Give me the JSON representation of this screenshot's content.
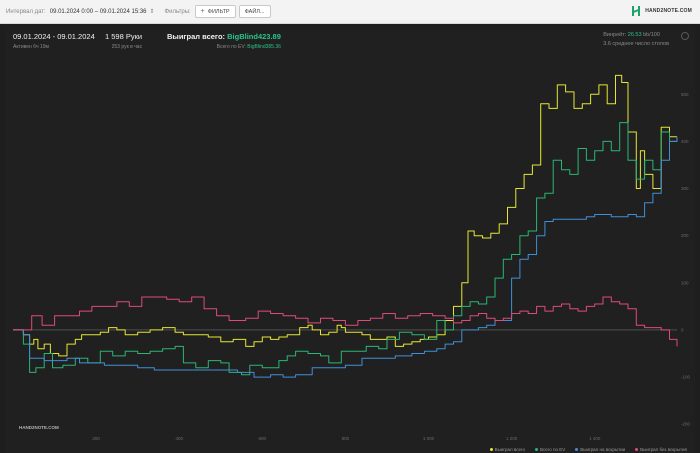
{
  "topbar": {
    "date_label": "Интервал дат:",
    "date_range": "09.01.2024 0:00 – 09.01.2024 15:36",
    "filters_label": "Фильтры:",
    "filter_button": "ФИЛЬТР",
    "file_button": "ФАЙЛ...",
    "logo_text": "HAND2NOTE.COM"
  },
  "stats": {
    "date_range": "09.01.2024 - 09.01.2024",
    "active": "Активен 6ч 19м",
    "hands": "1 598 Руки",
    "hands_per_hour": "253 рук в час",
    "won_label": "Выиграл всего:",
    "won_value": "BigBlind423.89",
    "ev_label": "Всего по EV:",
    "ev_value": "BigBlind385.36",
    "winrate_label": "Винрейт:",
    "winrate_value": "26.53",
    "winrate_unit": "bb/100",
    "tables": "3.6 среднее число столов"
  },
  "colors": {
    "total": "#e6e632",
    "ev": "#2bb673",
    "showdown": "#3f8fd8",
    "nonshowdown": "#e04a7a",
    "accent": "#29c38a"
  },
  "watermark": "HAND2NOTE.COM",
  "chart_data": {
    "type": "line",
    "xlabel": "",
    "ylabel": "",
    "x_ticks": [
      "200",
      "400",
      "600",
      "800",
      "1 000",
      "1 200",
      "1 400"
    ],
    "y_ticks": [
      "500",
      "400",
      "300",
      "200",
      "100",
      "0",
      "-100",
      "-200"
    ],
    "ylim": [
      -225,
      560
    ],
    "xlim": [
      0,
      1598
    ],
    "grid": false,
    "legend_position": "bottom-right",
    "series": [
      {
        "name": "Выиграл всего",
        "color": "#e6e632",
        "points": [
          [
            0,
            0
          ],
          [
            25,
            -10
          ],
          [
            40,
            -30
          ],
          [
            50,
            -20
          ],
          [
            60,
            -40
          ],
          [
            75,
            -30
          ],
          [
            90,
            -50
          ],
          [
            110,
            -55
          ],
          [
            130,
            -30
          ],
          [
            150,
            -20
          ],
          [
            165,
            -10
          ],
          [
            190,
            -10
          ],
          [
            210,
            -5
          ],
          [
            230,
            5
          ],
          [
            250,
            0
          ],
          [
            270,
            -10
          ],
          [
            300,
            -5
          ],
          [
            330,
            0
          ],
          [
            360,
            5
          ],
          [
            390,
            -5
          ],
          [
            410,
            -10
          ],
          [
            440,
            -10
          ],
          [
            470,
            -15
          ],
          [
            500,
            -25
          ],
          [
            530,
            -20
          ],
          [
            560,
            -35
          ],
          [
            580,
            -25
          ],
          [
            600,
            -15
          ],
          [
            620,
            -20
          ],
          [
            640,
            -15
          ],
          [
            660,
            -10
          ],
          [
            690,
            5
          ],
          [
            710,
            10
          ],
          [
            720,
            0
          ],
          [
            740,
            -10
          ],
          [
            760,
            -5
          ],
          [
            780,
            10
          ],
          [
            790,
            5
          ],
          [
            800,
            -5
          ],
          [
            820,
            -5
          ],
          [
            840,
            -10
          ],
          [
            860,
            -20
          ],
          [
            880,
            -20
          ],
          [
            900,
            -15
          ],
          [
            920,
            -35
          ],
          [
            940,
            -30
          ],
          [
            960,
            -25
          ],
          [
            980,
            -20
          ],
          [
            1000,
            -15
          ],
          [
            1020,
            -10
          ],
          [
            1040,
            20
          ],
          [
            1060,
            50
          ],
          [
            1080,
            100
          ],
          [
            1095,
            210
          ],
          [
            1110,
            200
          ],
          [
            1130,
            195
          ],
          [
            1150,
            205
          ],
          [
            1170,
            225
          ],
          [
            1190,
            260
          ],
          [
            1210,
            300
          ],
          [
            1230,
            330
          ],
          [
            1250,
            350
          ],
          [
            1270,
            480
          ],
          [
            1290,
            470
          ],
          [
            1310,
            520
          ],
          [
            1330,
            505
          ],
          [
            1350,
            470
          ],
          [
            1370,
            480
          ],
          [
            1390,
            500
          ],
          [
            1410,
            520
          ],
          [
            1430,
            480
          ],
          [
            1450,
            540
          ],
          [
            1465,
            525
          ],
          [
            1480,
            420
          ],
          [
            1500,
            300
          ],
          [
            1510,
            380
          ],
          [
            1520,
            330
          ],
          [
            1540,
            300
          ],
          [
            1560,
            430
          ],
          [
            1580,
            410
          ],
          [
            1598,
            410
          ]
        ]
      },
      {
        "name": "Всего по EV",
        "color": "#2bb673",
        "points": [
          [
            0,
            0
          ],
          [
            25,
            -30
          ],
          [
            40,
            -90
          ],
          [
            55,
            -80
          ],
          [
            75,
            -50
          ],
          [
            95,
            -80
          ],
          [
            120,
            -75
          ],
          [
            150,
            -60
          ],
          [
            180,
            -70
          ],
          [
            210,
            -45
          ],
          [
            240,
            -55
          ],
          [
            270,
            -45
          ],
          [
            300,
            -50
          ],
          [
            330,
            -45
          ],
          [
            360,
            -40
          ],
          [
            390,
            -35
          ],
          [
            410,
            -70
          ],
          [
            440,
            -80
          ],
          [
            470,
            -65
          ],
          [
            500,
            -70
          ],
          [
            520,
            -90
          ],
          [
            550,
            -95
          ],
          [
            570,
            -75
          ],
          [
            600,
            -80
          ],
          [
            620,
            -80
          ],
          [
            640,
            -65
          ],
          [
            660,
            -55
          ],
          [
            680,
            -45
          ],
          [
            710,
            -50
          ],
          [
            740,
            -55
          ],
          [
            760,
            -70
          ],
          [
            790,
            -45
          ],
          [
            820,
            -45
          ],
          [
            850,
            -35
          ],
          [
            880,
            -40
          ],
          [
            900,
            -20
          ],
          [
            930,
            -5
          ],
          [
            960,
            -10
          ],
          [
            990,
            -20
          ],
          [
            1020,
            20
          ],
          [
            1040,
            0
          ],
          [
            1060,
            30
          ],
          [
            1080,
            50
          ],
          [
            1100,
            60
          ],
          [
            1120,
            55
          ],
          [
            1140,
            70
          ],
          [
            1160,
            110
          ],
          [
            1180,
            150
          ],
          [
            1200,
            160
          ],
          [
            1220,
            200
          ],
          [
            1240,
            210
          ],
          [
            1260,
            280
          ],
          [
            1280,
            290
          ],
          [
            1300,
            360
          ],
          [
            1320,
            340
          ],
          [
            1340,
            330
          ],
          [
            1360,
            385
          ],
          [
            1380,
            360
          ],
          [
            1400,
            380
          ],
          [
            1420,
            400
          ],
          [
            1440,
            380
          ],
          [
            1460,
            440
          ],
          [
            1480,
            360
          ],
          [
            1500,
            320
          ],
          [
            1520,
            360
          ],
          [
            1540,
            340
          ],
          [
            1560,
            420
          ],
          [
            1580,
            400
          ],
          [
            1598,
            410
          ]
        ]
      },
      {
        "name": "Выиграл на вскрытии",
        "color": "#3f8fd8",
        "points": [
          [
            0,
            0
          ],
          [
            25,
            -10
          ],
          [
            40,
            -60
          ],
          [
            55,
            -60
          ],
          [
            75,
            -65
          ],
          [
            100,
            -65
          ],
          [
            130,
            -60
          ],
          [
            160,
            -70
          ],
          [
            190,
            -70
          ],
          [
            220,
            -75
          ],
          [
            260,
            -75
          ],
          [
            300,
            -80
          ],
          [
            340,
            -85
          ],
          [
            380,
            -85
          ],
          [
            420,
            -85
          ],
          [
            460,
            -85
          ],
          [
            500,
            -85
          ],
          [
            540,
            -90
          ],
          [
            580,
            -100
          ],
          [
            600,
            -100
          ],
          [
            620,
            -95
          ],
          [
            650,
            -100
          ],
          [
            680,
            -95
          ],
          [
            720,
            -80
          ],
          [
            760,
            -80
          ],
          [
            800,
            -75
          ],
          [
            840,
            -60
          ],
          [
            880,
            -60
          ],
          [
            920,
            -55
          ],
          [
            960,
            -50
          ],
          [
            990,
            -45
          ],
          [
            1020,
            -40
          ],
          [
            1040,
            -30
          ],
          [
            1060,
            -25
          ],
          [
            1080,
            0
          ],
          [
            1100,
            0
          ],
          [
            1120,
            5
          ],
          [
            1140,
            10
          ],
          [
            1160,
            20
          ],
          [
            1180,
            20
          ],
          [
            1200,
            110
          ],
          [
            1220,
            150
          ],
          [
            1240,
            160
          ],
          [
            1260,
            200
          ],
          [
            1280,
            230
          ],
          [
            1300,
            235
          ],
          [
            1320,
            235
          ],
          [
            1340,
            235
          ],
          [
            1360,
            235
          ],
          [
            1380,
            240
          ],
          [
            1400,
            245
          ],
          [
            1420,
            245
          ],
          [
            1440,
            240
          ],
          [
            1460,
            240
          ],
          [
            1480,
            245
          ],
          [
            1500,
            240
          ],
          [
            1520,
            270
          ],
          [
            1540,
            290
          ],
          [
            1560,
            360
          ],
          [
            1580,
            400
          ],
          [
            1598,
            410
          ]
        ]
      },
      {
        "name": "Выиграл без вскрытия",
        "color": "#e04a7a",
        "points": [
          [
            0,
            0
          ],
          [
            25,
            0
          ],
          [
            45,
            30
          ],
          [
            70,
            10
          ],
          [
            100,
            30
          ],
          [
            130,
            30
          ],
          [
            160,
            40
          ],
          [
            190,
            50
          ],
          [
            220,
            50
          ],
          [
            250,
            60
          ],
          [
            280,
            50
          ],
          [
            310,
            70
          ],
          [
            340,
            70
          ],
          [
            370,
            65
          ],
          [
            400,
            60
          ],
          [
            430,
            70
          ],
          [
            460,
            45
          ],
          [
            490,
            30
          ],
          [
            520,
            20
          ],
          [
            560,
            25
          ],
          [
            590,
            40
          ],
          [
            620,
            35
          ],
          [
            650,
            30
          ],
          [
            680,
            25
          ],
          [
            710,
            15
          ],
          [
            740,
            25
          ],
          [
            770,
            20
          ],
          [
            800,
            10
          ],
          [
            830,
            20
          ],
          [
            860,
            25
          ],
          [
            890,
            35
          ],
          [
            920,
            25
          ],
          [
            950,
            30
          ],
          [
            980,
            35
          ],
          [
            1010,
            30
          ],
          [
            1040,
            25
          ],
          [
            1060,
            15
          ],
          [
            1080,
            20
          ],
          [
            1100,
            30
          ],
          [
            1120,
            35
          ],
          [
            1140,
            25
          ],
          [
            1160,
            20
          ],
          [
            1180,
            25
          ],
          [
            1200,
            35
          ],
          [
            1220,
            40
          ],
          [
            1240,
            35
          ],
          [
            1260,
            50
          ],
          [
            1280,
            40
          ],
          [
            1300,
            50
          ],
          [
            1320,
            55
          ],
          [
            1340,
            45
          ],
          [
            1360,
            40
          ],
          [
            1380,
            50
          ],
          [
            1400,
            55
          ],
          [
            1420,
            70
          ],
          [
            1440,
            60
          ],
          [
            1460,
            55
          ],
          [
            1480,
            45
          ],
          [
            1500,
            10
          ],
          [
            1520,
            5
          ],
          [
            1540,
            5
          ],
          [
            1560,
            0
          ],
          [
            1580,
            -20
          ],
          [
            1598,
            -35
          ]
        ]
      }
    ]
  }
}
